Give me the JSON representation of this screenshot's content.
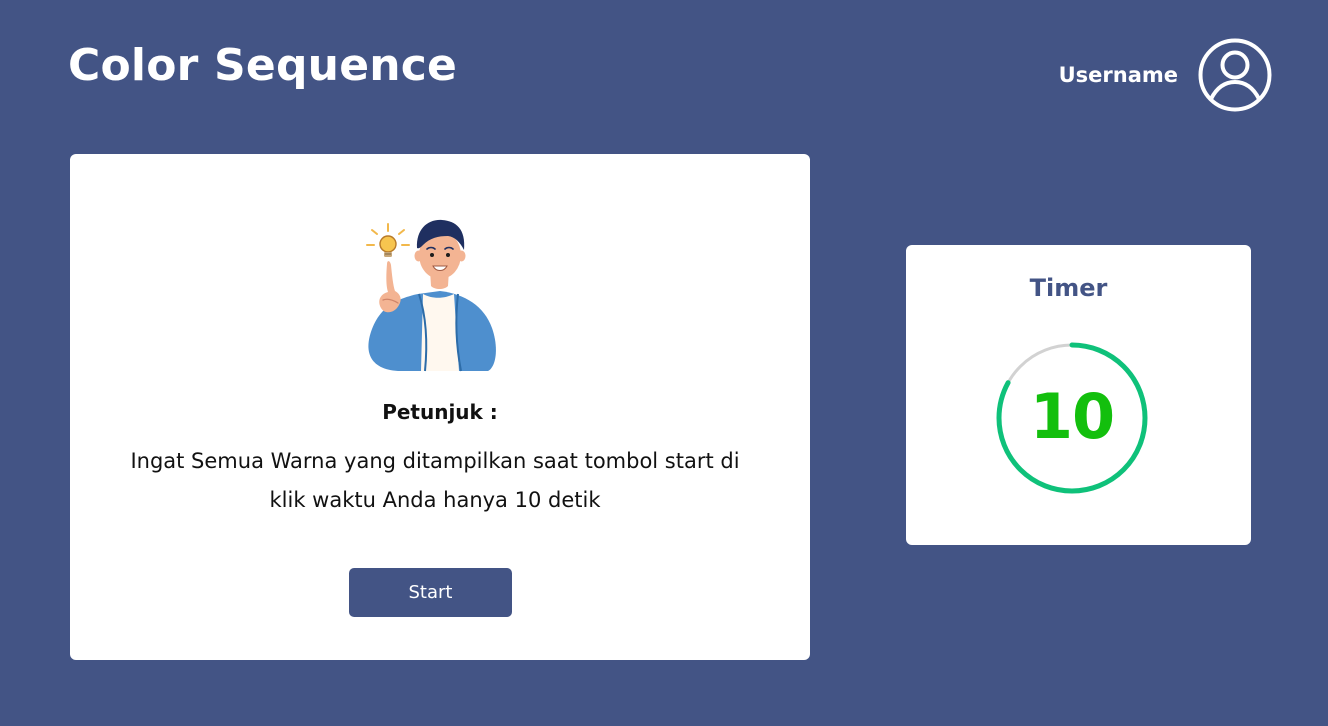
{
  "header": {
    "title": "Color Sequence",
    "username": "Username",
    "avatar_icon": "user-avatar-icon"
  },
  "instruction": {
    "illustration_icon": "thinking-person-lightbulb-illustration",
    "heading": "Petunjuk :",
    "body": "Ingat Semua Warna yang ditampilkan saat tombol start di klik waktu Anda hanya 10 detik",
    "start_label": "Start"
  },
  "timer": {
    "title": "Timer",
    "value": "10",
    "progress_fraction": 0.83
  },
  "colors": {
    "background": "#435485",
    "card": "#ffffff",
    "accent": "#435485",
    "timer_text": "#13bf0d",
    "timer_progress": "#0fc17a",
    "timer_track": "#d2d2d2"
  }
}
